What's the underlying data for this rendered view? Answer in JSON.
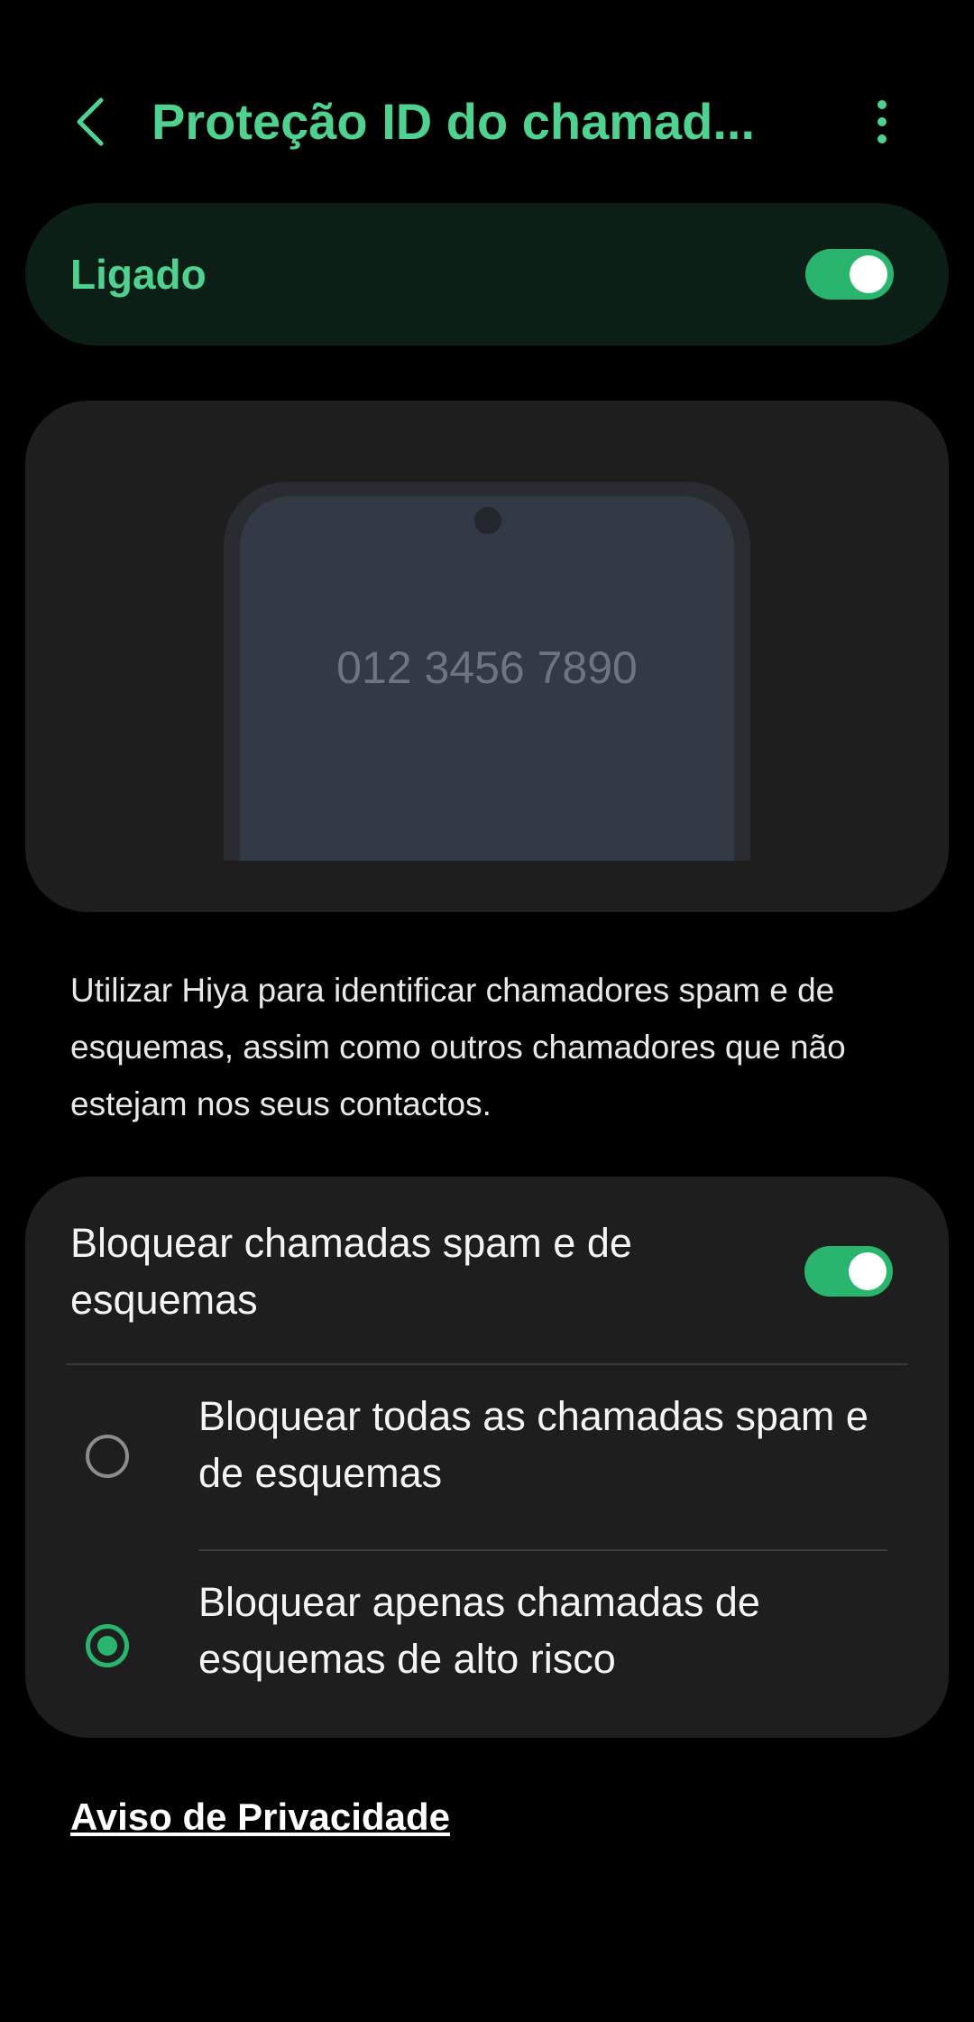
{
  "header": {
    "title": "Proteção ID do chamad...",
    "back_icon": "chevron-left-icon",
    "more_icon": "more-vert-icon"
  },
  "master": {
    "label": "Ligado",
    "enabled": true
  },
  "illustration": {
    "phone_number": "012 3456 7890"
  },
  "description": "Utilizar Hiya para identificar chamadores spam e de esquemas, assim como outros chamadores que não estejam nos seus contactos.",
  "block": {
    "title": "Bloquear chamadas spam e de esquemas",
    "enabled": true,
    "options": [
      {
        "label": "Bloquear todas as chamadas spam e de esquemas",
        "selected": false
      },
      {
        "label": "Bloquear apenas chamadas de esquemas de alto risco",
        "selected": true
      }
    ]
  },
  "privacy_link": "Aviso de Privacidade",
  "colors": {
    "accent": "#4fd28f",
    "toggle_on": "#2ab56e",
    "card_bg": "#1e1e1e",
    "master_card_bg": "#0b1f16",
    "background": "#000000"
  }
}
